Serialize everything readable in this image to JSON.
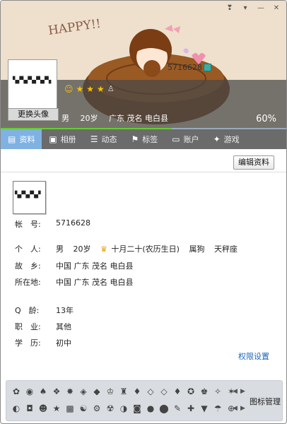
{
  "window": {
    "controls": [
      "feedback-icon",
      "skin-icon",
      "minimize-icon",
      "close-icon"
    ]
  },
  "header": {
    "handwriting": "HAPPY!!",
    "change_avatar_label": "更换头像",
    "qq_number_top": "5716628",
    "level_icons": [
      "sun-face-icon",
      "star-icon",
      "star-icon",
      "star-icon",
      "tux-icon"
    ],
    "basic": {
      "gender": "男",
      "age": "20岁",
      "location": "广东 茂名 电白县"
    },
    "completion_text": "60%",
    "completion_fraction": 0.6
  },
  "tabs": [
    {
      "label": "资料",
      "icon": "profile-card-icon",
      "active": true
    },
    {
      "label": "相册",
      "icon": "photo-icon",
      "active": false
    },
    {
      "label": "动态",
      "icon": "feed-icon",
      "active": false
    },
    {
      "label": "标签",
      "icon": "tag-icon",
      "active": false
    },
    {
      "label": "账户",
      "icon": "briefcase-icon",
      "active": false
    },
    {
      "label": "游戏",
      "icon": "game-icon",
      "active": false
    }
  ],
  "edit_button_label": "编辑资料",
  "profile": {
    "account": {
      "label": "帐　号:",
      "value": "5716628"
    },
    "personal": {
      "label": "个　人:",
      "gender": "男",
      "age": "20岁",
      "birthday": "十月二十(农历生日)",
      "zodiac": "属狗",
      "constellation": "天秤座"
    },
    "hometown": {
      "label": "故　乡:",
      "value": "中国 广东 茂名 电白县"
    },
    "location": {
      "label": "所在地:",
      "value": "中国 广东 茂名 电白县"
    },
    "q_age": {
      "label": "Q　龄:",
      "value": "13年"
    },
    "job": {
      "label": "职　业:",
      "value": "其他"
    },
    "education": {
      "label": "学　历:",
      "value": "初中"
    }
  },
  "permission_link": "权限设置",
  "icon_tray": {
    "row1_count": 17,
    "row2_count": 17,
    "manage_label": "图标管理"
  }
}
